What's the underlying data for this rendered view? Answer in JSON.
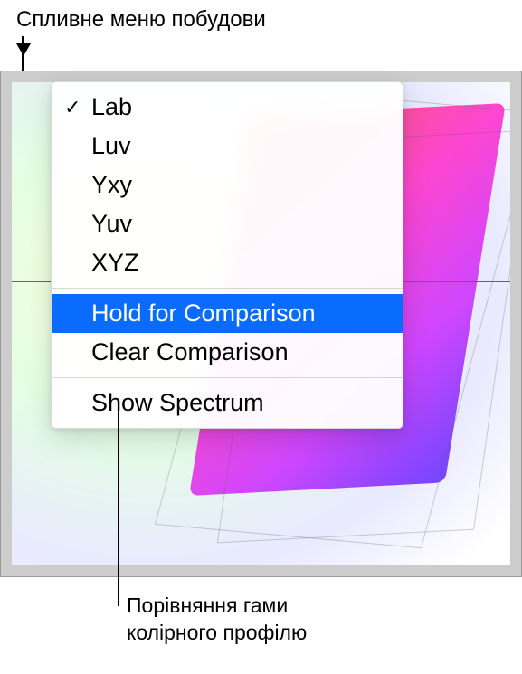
{
  "annotations": {
    "top_label": "Спливне меню побудови",
    "bottom_label_line1": "Порівняння гами",
    "bottom_label_line2": "колірного профілю"
  },
  "menu": {
    "items": [
      {
        "label": "Lab",
        "checked": true
      },
      {
        "label": "Luv",
        "checked": false
      },
      {
        "label": "Yxy",
        "checked": false
      },
      {
        "label": "Yuv",
        "checked": false
      },
      {
        "label": "XYZ",
        "checked": false
      }
    ],
    "hold_label": "Hold for Comparison",
    "clear_label": "Clear Comparison",
    "spectrum_label": "Show Spectrum"
  }
}
